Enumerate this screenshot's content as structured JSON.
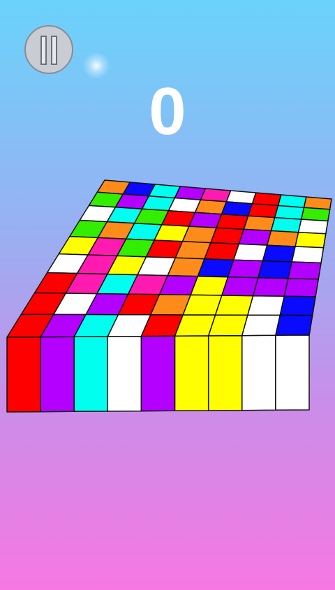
{
  "hud": {
    "score": "0",
    "pause_icon": "pause-icon"
  },
  "colors": {
    "red": "#ff0000",
    "orange": "#ff8c1a",
    "yellow": "#ffff00",
    "green": "#33ee00",
    "cyan": "#00ffee",
    "blue": "#0a0aff",
    "magenta": "#ff1ab0",
    "purple": "#b300ff",
    "white": "#ffffff"
  },
  "board": {
    "top_rows": [
      [
        "orange",
        "blue",
        "cyan",
        "purple",
        "magenta",
        "white",
        "red",
        "cyan",
        "orange"
      ],
      [
        "green",
        "purple",
        "cyan",
        "white",
        "orange",
        "blue",
        "red",
        "cyan",
        "green"
      ],
      [
        "white",
        "cyan",
        "green",
        "red",
        "purple",
        "red",
        "orange",
        "cyan",
        "white"
      ],
      [
        "green",
        "orange",
        "cyan",
        "yellow",
        "orange",
        "red",
        "purple",
        "orange",
        "yellow"
      ],
      [
        "yellow",
        "magenta",
        "green",
        "red",
        "orange",
        "red",
        "white",
        "blue",
        "white"
      ],
      [
        "white",
        "magenta",
        "yellow",
        "white",
        "orange",
        "blue",
        "purple",
        "blue",
        "purple"
      ],
      [
        "red",
        "magenta",
        "cyan",
        "magenta",
        "purple",
        "yellow",
        "purple",
        "purple",
        "purple"
      ],
      [
        "red",
        "white",
        "purple",
        "red",
        "orange",
        "yellow",
        "yellow",
        "white",
        "blue"
      ],
      [
        "red",
        "purple",
        "cyan",
        "white",
        "red",
        "yellow",
        "yellow",
        "white",
        "blue"
      ]
    ],
    "front_faces": [
      "red",
      "purple",
      "cyan",
      "white",
      "purple",
      "yellow",
      "yellow",
      "white",
      "white"
    ]
  }
}
